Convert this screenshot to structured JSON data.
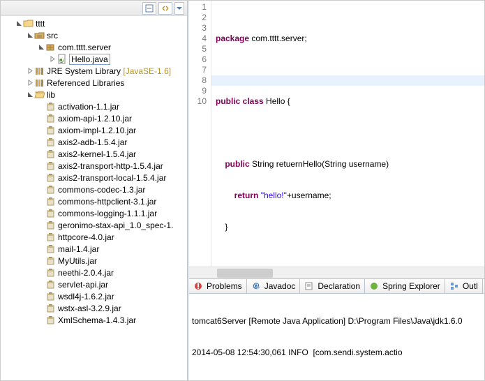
{
  "tree": {
    "project": "tttt",
    "src": "src",
    "pkg": "com.tttt.server",
    "file": "Hello.java",
    "jre": {
      "label": "JRE System Library",
      "decor": "[JavaSE-1.6]"
    },
    "ref": "Referenced Libraries",
    "lib": "lib",
    "jars": [
      "activation-1.1.jar",
      "axiom-api-1.2.10.jar",
      "axiom-impl-1.2.10.jar",
      "axis2-adb-1.5.4.jar",
      "axis2-kernel-1.5.4.jar",
      "axis2-transport-http-1.5.4.jar",
      "axis2-transport-local-1.5.4.jar",
      "commons-codec-1.3.jar",
      "commons-httpclient-3.1.jar",
      "commons-logging-1.1.1.jar",
      "geronimo-stax-api_1.0_spec-1.",
      "httpcore-4.0.jar",
      "mail-1.4.jar",
      "MyUtils.jar",
      "neethi-2.0.4.jar",
      "servlet-api.jar",
      "wsdl4j-1.6.2.jar",
      "wstx-asl-3.2.9.jar",
      "XmlSchema-1.4.3.jar"
    ]
  },
  "code": {
    "lines": [
      "1",
      "2",
      "3",
      "4",
      "5",
      "6",
      "7",
      "8",
      "9",
      "10"
    ],
    "l1": {
      "kw": "package",
      "rest": " com.tttt.server;"
    },
    "l3a": "public",
    "l3b": " class",
    "l3c": " Hello {",
    "l5a": "public",
    "l5b": " String retuernHello(String username)",
    "l6a": "return",
    "l6b": " ",
    "l6str": "\"hello!\"",
    "l6c": "+username;",
    "l7": "}",
    "l9": "}"
  },
  "tabs": {
    "problems": "Problems",
    "javadoc": "Javadoc",
    "declaration": "Declaration",
    "spring": "Spring Explorer",
    "outline": "Outl"
  },
  "console": {
    "l1": "tomcat6Server [Remote Java Application] D:\\Program Files\\Java\\jdk1.6.0",
    "l2": "2014-05-08 12:54:30,061 INFO  [com.sendi.system.actio"
  }
}
